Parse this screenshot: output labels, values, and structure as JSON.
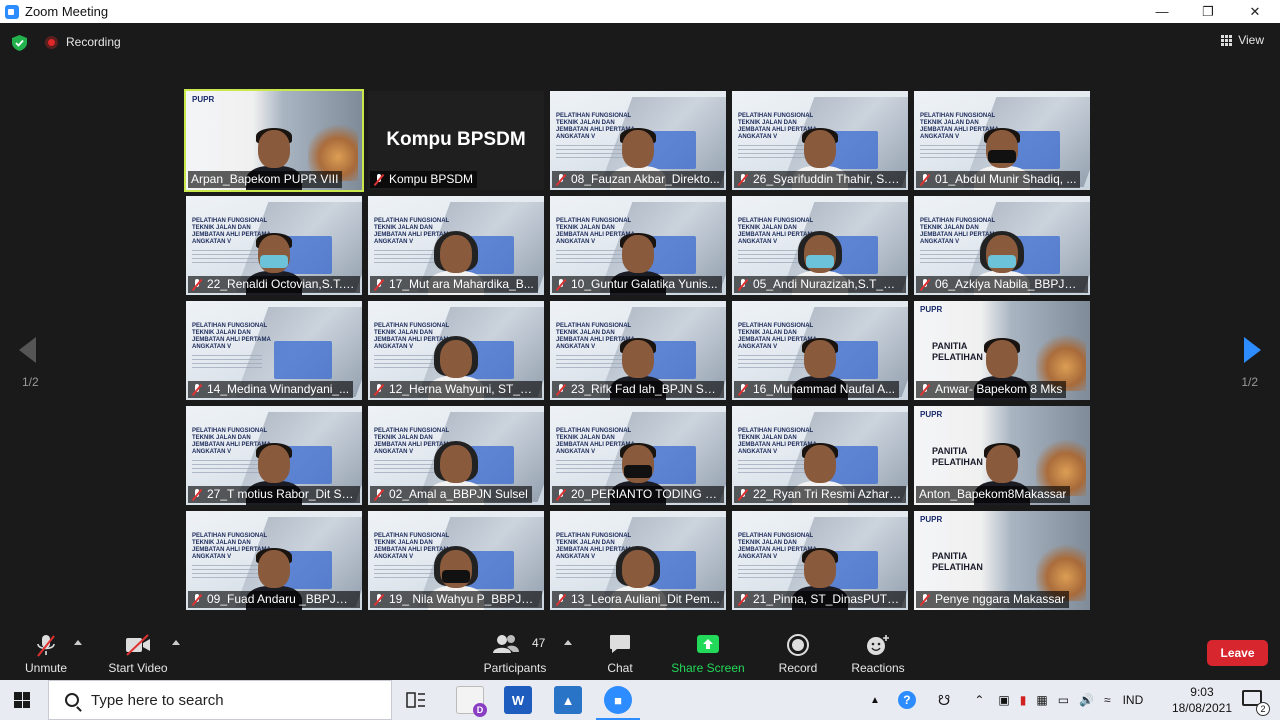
{
  "window": {
    "title": "Zoom Meeting"
  },
  "meeting": {
    "recording_label": "Recording",
    "view_label": "View",
    "page_indicator_left": "1/2",
    "page_indicator_right": "1/2"
  },
  "tiles": [
    {
      "name": "Arpan_Bapekom PUPR VIII",
      "bg": "city",
      "person": "dark-shirt",
      "active": true,
      "muted": false
    },
    {
      "name": "Kompu BPSDM",
      "bg": "dark",
      "caption": "Kompu BPSDM",
      "muted": true
    },
    {
      "name": "08_Fauzan Akbar_Direkto...",
      "bg": "road",
      "person": "shirt",
      "muted": true
    },
    {
      "name": "26_Syarifuddin Thahir, S.T...",
      "bg": "road",
      "person": "shirt",
      "muted": true
    },
    {
      "name": "01_Abdul Munir Shadiq, ...",
      "bg": "road",
      "person": "shirt-mask-black",
      "muted": true
    },
    {
      "name": "22_Renaldi Octovian,S.T._...",
      "bg": "road",
      "person": "dark-mask",
      "muted": true
    },
    {
      "name": "17_Mut ara Mahardika_B...",
      "bg": "road",
      "person": "hijab",
      "muted": true
    },
    {
      "name": "10_Guntur Galatika Yunis...",
      "bg": "road",
      "person": "dark-shirt",
      "muted": true
    },
    {
      "name": "05_Andi Nurazizah,S.T_Di...",
      "bg": "road",
      "person": "hijab-mask",
      "muted": true
    },
    {
      "name": "06_Azkiya Nabila_BBPJN J...",
      "bg": "road",
      "person": "hijab-mask",
      "muted": true
    },
    {
      "name": "14_Medina Winandyani_...",
      "bg": "road",
      "person": "none",
      "muted": true
    },
    {
      "name": "12_Herna Wahyuni, ST_Di...",
      "bg": "road",
      "person": "hijab",
      "muted": true
    },
    {
      "name": "23_Rifk  Fad lah_BPJN Sul...",
      "bg": "road",
      "person": "dark-shirt",
      "muted": true
    },
    {
      "name": "16_Muhammad Naufal A...",
      "bg": "road",
      "person": "dark-shirt",
      "muted": true
    },
    {
      "name": "Anwar- Bapekom 8 Mks",
      "bg": "city",
      "caption_panitia": "PANITIA\nPELATIHAN",
      "person": "dark-shirt",
      "muted": true
    },
    {
      "name": "27_T motius Rabor_Dit SS...",
      "bg": "road",
      "person": "dark-shirt",
      "muted": true
    },
    {
      "name": "02_Amal a_BBPJN Sulsel",
      "bg": "road",
      "person": "hijab",
      "muted": true
    },
    {
      "name": "20_PERIANTO TODING LA...",
      "bg": "road",
      "person": "dark-mask-black",
      "muted": true
    },
    {
      "name": "22_Ryan Tri Resmi Azhari_...",
      "bg": "road",
      "person": "shirt",
      "muted": true
    },
    {
      "name": "Anton_Bapekom8Makassar",
      "bg": "city",
      "caption_panitia": "PANITIA\nPELATIHAN",
      "person": "dark-shirt",
      "muted": false
    },
    {
      "name": "09_Fuad Andaru _BBPJN J...",
      "bg": "road",
      "person": "dark-shirt",
      "muted": true
    },
    {
      "name": "19_ Nila Wahyu P_BBPJN ...",
      "bg": "road",
      "person": "hijab-mask-black",
      "muted": true
    },
    {
      "name": "13_Leora Auliani_Dit Pem...",
      "bg": "road",
      "person": "hijab",
      "muted": true
    },
    {
      "name": "21_Pinna, ST_DinasPUTRS...",
      "bg": "road",
      "person": "dark-shirt",
      "muted": true
    },
    {
      "name": "Penye nggara Makassar",
      "bg": "city",
      "caption_panitia": "PANITIA\nPELATIHAN",
      "person": "none",
      "muted": true
    }
  ],
  "slide": {
    "road_title": "PELATIHAN FUNGSIONAL TEKNIK JALAN DAN JEMBATAN AHLI PERTAMA ANGKATAN V",
    "pupr_logo": "PUPR"
  },
  "toolbar": {
    "unmute": "Unmute",
    "start_video": "Start Video",
    "participants": "Participants",
    "participants_count": "47",
    "chat": "Chat",
    "share_screen": "Share Screen",
    "record": "Record",
    "reactions": "Reactions",
    "leave": "Leave"
  },
  "taskbar": {
    "search_placeholder": "Type here to search",
    "language": "IND",
    "time": "9:03",
    "date": "18/08/2021",
    "notification_count": "2"
  },
  "colors": {
    "accent_blue": "#2d8cff",
    "share_green": "#23d959",
    "leave_red": "#d8262e",
    "active_border": "#c9e84b"
  }
}
